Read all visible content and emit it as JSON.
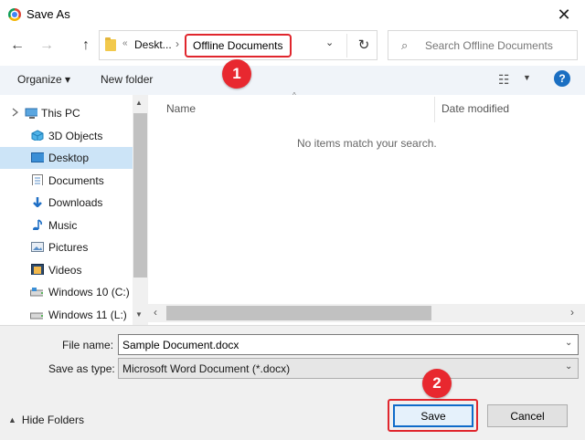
{
  "window": {
    "title": "Save As",
    "close_glyph": "✕",
    "app_icon": "chrome-icon"
  },
  "nav": {
    "back": "←",
    "forward": "→",
    "up": "↑"
  },
  "address": {
    "chevrons": "«",
    "parent": "Deskt...",
    "separator": "›",
    "current": "Offline Documents",
    "dropdown": "⌄",
    "refresh": "↻"
  },
  "search": {
    "icon": "⌕",
    "placeholder": "Search Offline Documents"
  },
  "annotations": {
    "badge1": "1",
    "badge2": "2",
    "color": "#e0262d"
  },
  "toolbar": {
    "organize": "Organize ▾",
    "new_folder": "New folder",
    "view_icon": "☷",
    "view_dropdown": "▼",
    "help": "?"
  },
  "sidebar": {
    "items": [
      {
        "label": "This PC",
        "icon": "pc-icon"
      },
      {
        "label": "3D Objects",
        "icon": "cube-icon"
      },
      {
        "label": "Desktop",
        "icon": "desktop-icon",
        "selected": true
      },
      {
        "label": "Documents",
        "icon": "documents-icon"
      },
      {
        "label": "Downloads",
        "icon": "download-icon"
      },
      {
        "label": "Music",
        "icon": "music-icon"
      },
      {
        "label": "Pictures",
        "icon": "pictures-icon"
      },
      {
        "label": "Videos",
        "icon": "videos-icon"
      },
      {
        "label": "Windows 10 (C:)",
        "icon": "drive-icon"
      },
      {
        "label": "Windows 11 (L:)",
        "icon": "drive-icon"
      }
    ]
  },
  "file_list": {
    "columns": [
      "Name",
      "Date modified"
    ],
    "sort_indicator": "^",
    "empty_message": "No items match your search."
  },
  "form": {
    "filename_label": "File name:",
    "filename_value": "Sample Document.docx",
    "savetype_label": "Save as type:",
    "savetype_value": "Microsoft Word Document (*.docx)",
    "dropdown_glyph": "⌄"
  },
  "footer": {
    "hide_folders": "Hide Folders",
    "hide_glyph": "▲",
    "save": "Save",
    "cancel": "Cancel"
  },
  "scroll": {
    "up": "▲",
    "down": "▼",
    "left": "‹",
    "right": "›"
  }
}
